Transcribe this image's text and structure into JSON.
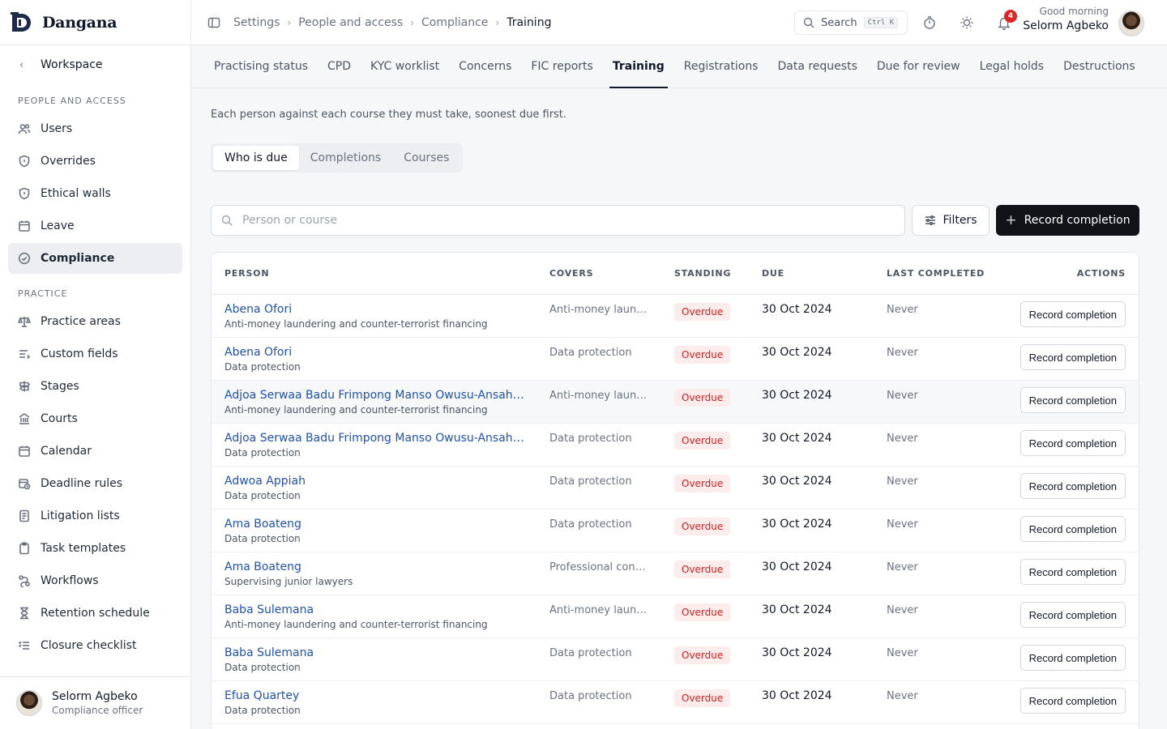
{
  "brand": {
    "name": "Dangana"
  },
  "sidebar": {
    "workspace_label": "Workspace",
    "sections": [
      {
        "label": "PEOPLE AND ACCESS",
        "items": [
          {
            "label": "Users",
            "icon": "users-icon"
          },
          {
            "label": "Overrides",
            "icon": "shield-icon"
          },
          {
            "label": "Ethical walls",
            "icon": "shield-icon"
          },
          {
            "label": "Leave",
            "icon": "calendar-icon"
          },
          {
            "label": "Compliance",
            "icon": "check-circle-icon",
            "active": true
          }
        ]
      },
      {
        "label": "PRACTICE",
        "items": [
          {
            "label": "Practice areas",
            "icon": "scales-icon"
          },
          {
            "label": "Custom fields",
            "icon": "list-icon"
          },
          {
            "label": "Stages",
            "icon": "signpost-icon"
          },
          {
            "label": "Courts",
            "icon": "building-icon"
          },
          {
            "label": "Calendar",
            "icon": "calendar-icon"
          },
          {
            "label": "Deadline rules",
            "icon": "calendar-clock-icon"
          },
          {
            "label": "Litigation lists",
            "icon": "document-icon"
          },
          {
            "label": "Task templates",
            "icon": "clipboard-icon"
          },
          {
            "label": "Workflows",
            "icon": "workflow-icon"
          },
          {
            "label": "Retention schedule",
            "icon": "hourglass-icon"
          },
          {
            "label": "Closure checklist",
            "icon": "checklist-icon"
          }
        ]
      }
    ],
    "footer": {
      "name": "Selorm Agbeko",
      "role": "Compliance officer"
    }
  },
  "topbar": {
    "breadcrumbs": [
      "Settings",
      "People and access",
      "Compliance",
      "Training"
    ],
    "search_label": "Search",
    "search_shortcut": "Ctrl K",
    "notification_count": "4",
    "greeting": "Good morning",
    "user_name": "Selorm Agbeko"
  },
  "tabs": [
    {
      "label": "Practising status"
    },
    {
      "label": "CPD"
    },
    {
      "label": "KYC worklist"
    },
    {
      "label": "Concerns"
    },
    {
      "label": "FIC reports"
    },
    {
      "label": "Training",
      "active": true
    },
    {
      "label": "Registrations"
    },
    {
      "label": "Data requests"
    },
    {
      "label": "Due for review"
    },
    {
      "label": "Legal holds"
    },
    {
      "label": "Destructions"
    }
  ],
  "page": {
    "description": "Each person against each course they must take, soonest due first.",
    "segments": [
      {
        "label": "Who is due",
        "active": true
      },
      {
        "label": "Completions"
      },
      {
        "label": "Courses"
      }
    ],
    "filter_placeholder": "Person or course",
    "filters_label": "Filters",
    "primary_action": "Record completion"
  },
  "table": {
    "headers": {
      "person": "PERSON",
      "covers": "COVERS",
      "standing": "STANDING",
      "due": "DUE",
      "last": "LAST COMPLETED",
      "actions": "ACTIONS"
    },
    "rows": [
      {
        "name": "Abena Ofori",
        "course": "Anti-money laundering and counter-terrorist financing",
        "covers": "Anti-money laund...",
        "standing": "Overdue",
        "due": "30 Oct 2024",
        "last": "Never",
        "action": "Record completion"
      },
      {
        "name": "Abena Ofori",
        "course": "Data protection",
        "covers": "Data protection",
        "standing": "Overdue",
        "due": "30 Oct 2024",
        "last": "Never",
        "action": "Record completion"
      },
      {
        "name": "Adjoa Serwaa Badu Frimpong Manso Owusu-Ansah ...",
        "course": "Anti-money laundering and counter-terrorist financing",
        "covers": "Anti-money laund...",
        "standing": "Overdue",
        "due": "30 Oct 2024",
        "last": "Never",
        "action": "Record completion",
        "highlight": true
      },
      {
        "name": "Adjoa Serwaa Badu Frimpong Manso Owusu-Ansah ...",
        "course": "Data protection",
        "covers": "Data protection",
        "standing": "Overdue",
        "due": "30 Oct 2024",
        "last": "Never",
        "action": "Record completion"
      },
      {
        "name": "Adwoa Appiah",
        "course": "Data protection",
        "covers": "Data protection",
        "standing": "Overdue",
        "due": "30 Oct 2024",
        "last": "Never",
        "action": "Record completion"
      },
      {
        "name": "Ama Boateng",
        "course": "Data protection",
        "covers": "Data protection",
        "standing": "Overdue",
        "due": "30 Oct 2024",
        "last": "Never",
        "action": "Record completion"
      },
      {
        "name": "Ama Boateng",
        "course": "Supervising junior lawyers",
        "covers": "Professional cond...",
        "standing": "Overdue",
        "due": "30 Oct 2024",
        "last": "Never",
        "action": "Record completion"
      },
      {
        "name": "Baba Sulemana",
        "course": "Anti-money laundering and counter-terrorist financing",
        "covers": "Anti-money laund...",
        "standing": "Overdue",
        "due": "30 Oct 2024",
        "last": "Never",
        "action": "Record completion"
      },
      {
        "name": "Baba Sulemana",
        "course": "Data protection",
        "covers": "Data protection",
        "standing": "Overdue",
        "due": "30 Oct 2024",
        "last": "Never",
        "action": "Record completion"
      },
      {
        "name": "Efua Quartey",
        "course": "Data protection",
        "covers": "Data protection",
        "standing": "Overdue",
        "due": "30 Oct 2024",
        "last": "Never",
        "action": "Record completion"
      }
    ]
  },
  "colors": {
    "link": "#2051a6",
    "overdue_text": "#c81e1e",
    "overdue_bg": "#fdecec",
    "primary_button": "#111318",
    "notification": "#dc2626"
  }
}
